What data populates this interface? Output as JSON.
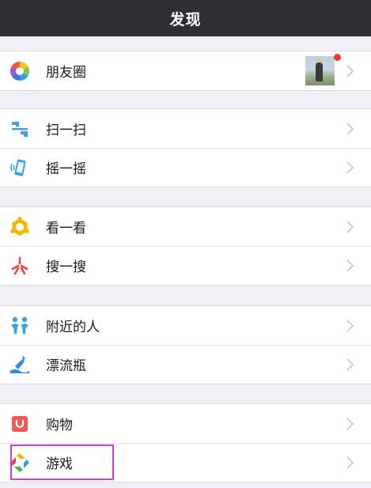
{
  "header": {
    "title": "发现"
  },
  "groups": [
    {
      "items": [
        {
          "label": "朋友圈",
          "icon": "moments-icon",
          "has_thumbnail": true,
          "has_red_dot": true
        }
      ]
    },
    {
      "items": [
        {
          "label": "扫一扫",
          "icon": "scan-icon"
        },
        {
          "label": "摇一摇",
          "icon": "shake-icon"
        }
      ]
    },
    {
      "items": [
        {
          "label": "看一看",
          "icon": "top-stories-icon"
        },
        {
          "label": "搜一搜",
          "icon": "search-icon"
        }
      ]
    },
    {
      "items": [
        {
          "label": "附近的人",
          "icon": "people-nearby-icon"
        },
        {
          "label": "漂流瓶",
          "icon": "drift-bottle-icon"
        }
      ]
    },
    {
      "items": [
        {
          "label": "购物",
          "icon": "shopping-icon"
        },
        {
          "label": "游戏",
          "icon": "games-icon",
          "highlighted": true
        }
      ]
    }
  ],
  "colors": {
    "header_bg": "#2f2f33",
    "page_bg": "#efeff4",
    "highlight": "#d63bd6",
    "badge_red": "#f43530"
  }
}
